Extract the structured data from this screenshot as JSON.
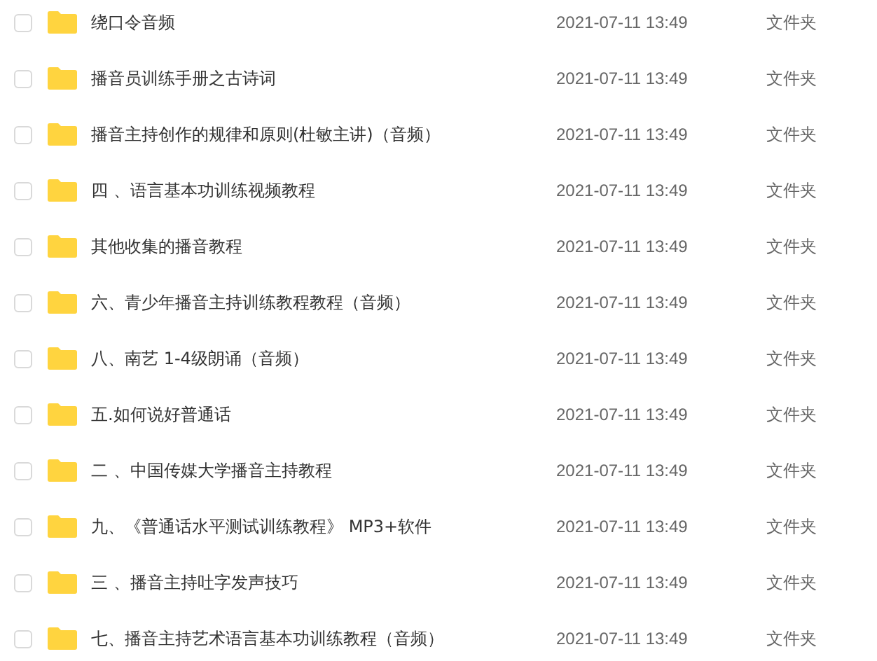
{
  "files": [
    {
      "name": "绕口令音频",
      "modified": "2021-07-11 13:49",
      "type": "文件夹",
      "checked": false
    },
    {
      "name": "播音员训练手册之古诗词",
      "modified": "2021-07-11 13:49",
      "type": "文件夹",
      "checked": false
    },
    {
      "name": "播音主持创作的规律和原则(杜敏主讲)（音频）",
      "modified": "2021-07-11 13:49",
      "type": "文件夹",
      "checked": false
    },
    {
      "name": "四 、语言基本功训练视频教程",
      "modified": "2021-07-11 13:49",
      "type": "文件夹",
      "checked": false
    },
    {
      "name": "其他收集的播音教程",
      "modified": "2021-07-11 13:49",
      "type": "文件夹",
      "checked": false
    },
    {
      "name": "六、青少年播音主持训练教程教程（音频）",
      "modified": "2021-07-11 13:49",
      "type": "文件夹",
      "checked": false
    },
    {
      "name": "八、南艺 1-4级朗诵（音频）",
      "modified": "2021-07-11 13:49",
      "type": "文件夹",
      "checked": false
    },
    {
      "name": "五.如何说好普通话",
      "modified": "2021-07-11 13:49",
      "type": "文件夹",
      "checked": false
    },
    {
      "name": "二 、中国传媒大学播音主持教程",
      "modified": "2021-07-11 13:49",
      "type": "文件夹",
      "checked": false
    },
    {
      "name": "九、《普通话水平测试训练教程》 MP3+软件",
      "modified": "2021-07-11 13:49",
      "type": "文件夹",
      "checked": false
    },
    {
      "name": "三 、播音主持吐字发声技巧",
      "modified": "2021-07-11 13:49",
      "type": "文件夹",
      "checked": false
    },
    {
      "name": "七、播音主持艺术语言基本功训练教程（音频）",
      "modified": "2021-07-11 13:49",
      "type": "文件夹",
      "checked": false
    }
  ]
}
